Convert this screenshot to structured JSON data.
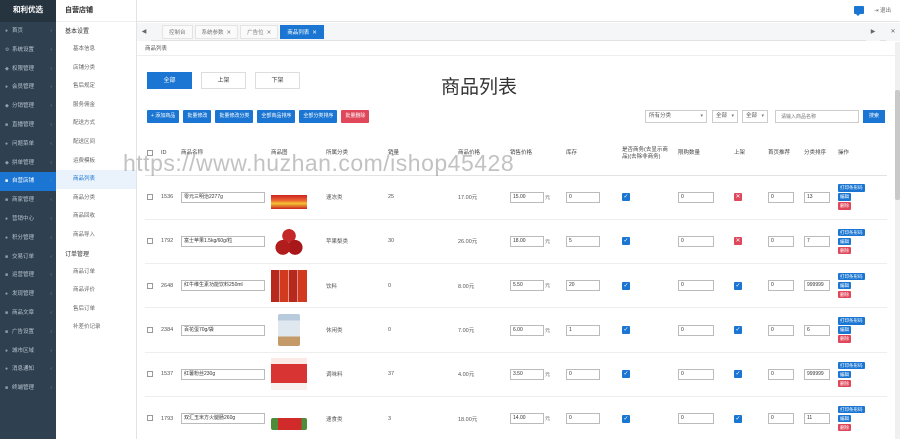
{
  "app": {
    "brand": "和利优选"
  },
  "sidebar": {
    "items": [
      {
        "label": "首页",
        "icon": "home-icon",
        "glyph": "●"
      },
      {
        "label": "系统设置",
        "icon": "gear-icon",
        "glyph": "⚙"
      },
      {
        "label": "权限管理",
        "icon": "lock-icon",
        "glyph": "◆"
      },
      {
        "label": "会员管理",
        "icon": "user-icon",
        "glyph": "●"
      },
      {
        "label": "分销管理",
        "icon": "share-icon",
        "glyph": "◆"
      },
      {
        "label": "直播管理",
        "icon": "video-icon",
        "glyph": "■"
      },
      {
        "label": "问题菜单",
        "icon": "help-icon",
        "glyph": "●"
      },
      {
        "label": "拼单管理",
        "icon": "group-icon",
        "glyph": "◆"
      },
      {
        "label": "自营店铺",
        "icon": "store-icon",
        "glyph": "■",
        "active": true
      },
      {
        "label": "商家管理",
        "icon": "shop-icon",
        "glyph": "■"
      },
      {
        "label": "营销中心",
        "icon": "megaphone-icon",
        "glyph": "●"
      },
      {
        "label": "积分管理",
        "icon": "coin-icon",
        "glyph": "●"
      },
      {
        "label": "交易订单",
        "icon": "cart-icon",
        "glyph": "■"
      },
      {
        "label": "运营管理",
        "icon": "chart-icon",
        "glyph": "■"
      },
      {
        "label": "发现管理",
        "icon": "compass-icon",
        "glyph": "●"
      },
      {
        "label": "商品文章",
        "icon": "document-icon",
        "glyph": "■"
      },
      {
        "label": "广告设置",
        "icon": "ad-icon",
        "glyph": "■"
      },
      {
        "label": "城市区域",
        "icon": "location-icon",
        "glyph": "●"
      },
      {
        "label": "消息通知",
        "icon": "bell-icon",
        "glyph": "●"
      },
      {
        "label": "终端管理",
        "icon": "terminal-icon",
        "glyph": "■"
      }
    ]
  },
  "subnav": {
    "title": "自营店铺",
    "groups": [
      {
        "label": "基本设置",
        "items": [
          {
            "label": "基本信息"
          },
          {
            "label": "店铺分类"
          },
          {
            "label": "售后规定"
          },
          {
            "label": "服务佣金"
          },
          {
            "label": "配送方式"
          },
          {
            "label": "配送区间"
          },
          {
            "label": "运费模板"
          },
          {
            "label": "商品列表",
            "active": true
          },
          {
            "label": "商品分类"
          },
          {
            "label": "商品回收"
          },
          {
            "label": "商品导入"
          }
        ]
      },
      {
        "label": "订单管理",
        "items": [
          {
            "label": "商品订单"
          },
          {
            "label": "商品评价"
          },
          {
            "label": "售后订单"
          },
          {
            "label": "补差价记录"
          }
        ]
      }
    ]
  },
  "topbar": {
    "logout": "退出"
  },
  "tabs": [
    {
      "label": "控制台",
      "closable": false
    },
    {
      "label": "系统参数",
      "closable": true
    },
    {
      "label": "广告位",
      "closable": true
    },
    {
      "label": "商品列表",
      "closable": true,
      "active": true
    }
  ],
  "panel": {
    "breadcrumb": "商品列表",
    "title": "商品列表"
  },
  "filter_tabs": [
    {
      "label": "全部",
      "active": true
    },
    {
      "label": "上架"
    },
    {
      "label": "下架"
    }
  ],
  "actions": [
    {
      "label": "+ 添加商品"
    },
    {
      "label": "批量修改"
    },
    {
      "label": "批量修改分类"
    },
    {
      "label": "全部商品排序"
    },
    {
      "label": "全部分类排序"
    },
    {
      "label": "批量删除",
      "danger": true
    }
  ],
  "filters": {
    "category": "所有分类",
    "select2": "全部",
    "select3": "全部",
    "search_placeholder": "请输入商品名称",
    "search_button": "搜索"
  },
  "table": {
    "columns": [
      "",
      "ID",
      "商品名称",
      "商品图",
      "所属分类",
      "销量",
      "商品价格",
      "销售价格",
      "库存",
      "是否商务(去显示商品)(去除非商务)",
      "限购数量",
      "上架",
      "首页推荐",
      "分类排序",
      "操作"
    ],
    "ops": {
      "print": "打印条形码",
      "edit": "编辑",
      "delete": "删除"
    },
    "rows": [
      {
        "id": "1536",
        "name": "零元三明治2277g",
        "category": "速冻类",
        "sales": "25",
        "price": "17.00元",
        "sale_price": "15.00",
        "stock": "0",
        "limit": "0",
        "commerce": true,
        "on_shelf": false,
        "home_rank": "0",
        "cat_rank": "13",
        "thumb": "t1"
      },
      {
        "id": "1792",
        "name": "富士苹果1.5kg/60g/粒",
        "category": "苹果梨类",
        "sales": "30",
        "price": "26.00元",
        "sale_price": "18.00",
        "stock": "5",
        "limit": "0",
        "commerce": true,
        "on_shelf": false,
        "home_rank": "0",
        "cat_rank": "7",
        "thumb": "t2"
      },
      {
        "id": "2648",
        "name": "红牛维生素功能饮料250ml",
        "category": "饮料",
        "sales": "0",
        "price": "8.00元",
        "sale_price": "5.50",
        "stock": "20",
        "limit": "0",
        "commerce": true,
        "on_shelf": true,
        "home_rank": "0",
        "cat_rank": "999999",
        "thumb": "t3"
      },
      {
        "id": "2384",
        "name": "百花蛋70g/袋",
        "category": "休闲类",
        "sales": "0",
        "price": "7.00元",
        "sale_price": "6.00",
        "stock": "1",
        "limit": "0",
        "commerce": true,
        "on_shelf": true,
        "home_rank": "0",
        "cat_rank": "6",
        "thumb": "t4"
      },
      {
        "id": "1537",
        "name": "红薯粉丝230g",
        "category": "调味料",
        "sales": "37",
        "price": "4.00元",
        "sale_price": "3.50",
        "stock": "0",
        "limit": "0",
        "commerce": true,
        "on_shelf": true,
        "home_rank": "0",
        "cat_rank": "999999",
        "thumb": "t5"
      },
      {
        "id": "1793",
        "name": "双汇玉米方火腿肠260g",
        "category": "速食类",
        "sales": "3",
        "price": "18.00元",
        "sale_price": "14.00",
        "stock": "0",
        "limit": "0",
        "commerce": true,
        "on_shelf": true,
        "home_rank": "0",
        "cat_rank": "11",
        "thumb": "t6"
      }
    ]
  },
  "watermark": "https://www.huzhan.com/ishop45428",
  "colors": {
    "sidebar": "#2f4050",
    "accent": "#1a76d2",
    "danger": "#e0475a"
  }
}
